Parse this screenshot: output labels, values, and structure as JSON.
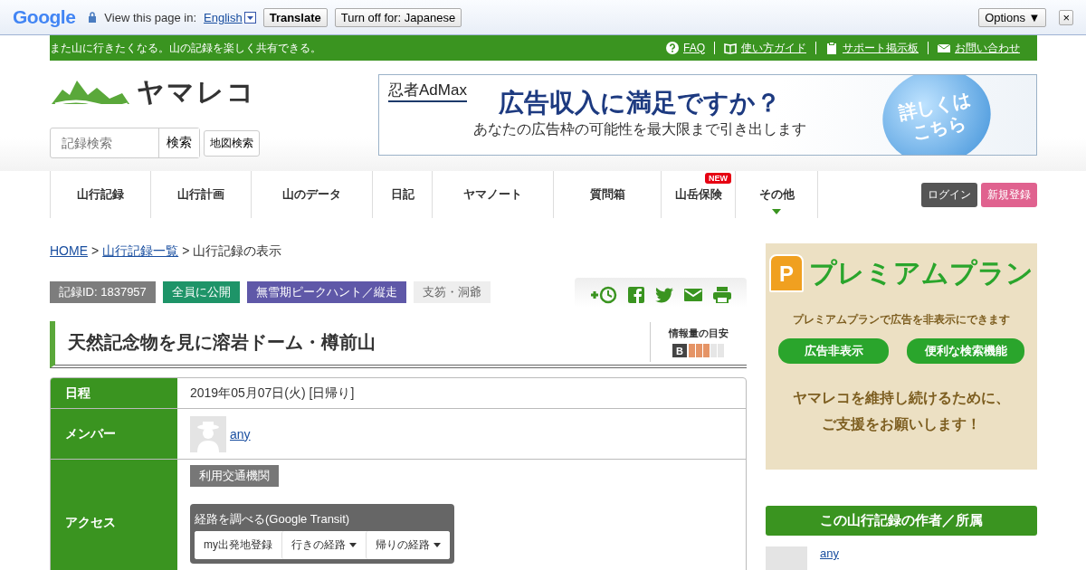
{
  "translate_bar": {
    "logo": "Google",
    "prompt": "View this page in:",
    "language": "English",
    "translate_button": "Translate",
    "turn_off_button": "Turn off for: Japanese",
    "options_button": "Options ▼",
    "close": "×"
  },
  "top_bar": {
    "tagline": "また山に行きたくなる。山の記録を楽しく共有できる。",
    "links": [
      {
        "label": "FAQ"
      },
      {
        "label": "使い方ガイド"
      },
      {
        "label": "サポート掲示板"
      },
      {
        "label": "お問い合わせ"
      }
    ]
  },
  "header": {
    "logo": "ヤマレコ",
    "search": {
      "placeholder": "記録検索",
      "button": "検索"
    },
    "map_search_button": "地図検索"
  },
  "ad_banner": {
    "brand": "忍者AdMax",
    "headline": "広告収入に満足ですか？",
    "subline": "あなたの広告枠の可能性を最大限まで引き出します",
    "cta_lines": [
      "詳しくは",
      "こちら"
    ]
  },
  "nav": {
    "items": [
      {
        "label": "山行記録"
      },
      {
        "label": "山行計画"
      },
      {
        "label": "山のデータ"
      },
      {
        "label": "日記"
      },
      {
        "label": "ヤマノート"
      },
      {
        "label": "質問箱"
      },
      {
        "label": "山岳保険",
        "badge": "NEW"
      },
      {
        "label": "その他",
        "has_menu": true
      }
    ],
    "account_buttons": [
      {
        "label": "ログイン",
        "kind": "login"
      },
      {
        "label": "新規登録",
        "kind": "register"
      }
    ]
  },
  "breadcrumb": {
    "separator": ">",
    "items": [
      {
        "label": "HOME",
        "link": true
      },
      {
        "label": "山行記録一覧",
        "link": true
      },
      {
        "label": "山行記録の表示",
        "link": false
      }
    ]
  },
  "tags": [
    {
      "label": "記録ID: 1837957",
      "color": "#7d7d7d"
    },
    {
      "label": "全員に公開",
      "color": "#1e9468"
    },
    {
      "label": "無雪期ピークハント／縦走",
      "color": "#5f58a8"
    },
    {
      "label": "支笏・洞爺",
      "color": "#eeeeee"
    }
  ],
  "title": "天然記念物を見に溶岩ドーム・樽前山",
  "info_meter": {
    "label": "情報量の目安",
    "grade": "B",
    "level": 0.6
  },
  "details": [
    {
      "kind": "date",
      "label": "日程",
      "value": "2019年05月07日(火) [日帰り]"
    },
    {
      "kind": "member",
      "label": "メンバー",
      "value": "any"
    },
    {
      "kind": "access",
      "label": "アクセス",
      "tag": "利用交通機関",
      "transit_title": "経路を調べる(Google Transit)",
      "transit_buttons": [
        {
          "label": "my出発地登録",
          "has_menu": false
        },
        {
          "label": "行きの経路",
          "has_menu": true
        },
        {
          "label": "帰りの経路",
          "has_menu": true
        }
      ]
    }
  ],
  "premium_banner": {
    "icon_letter": "P",
    "title": "プレミアムプラン",
    "subtitle": "プレミアムプランで広告を非表示にできます",
    "features": [
      "広告非表示",
      "便利な検索機能"
    ],
    "message_lines": [
      "ヤマレコを維持し続けるために、",
      "ご支援をお願いします！"
    ]
  },
  "author": {
    "heading": "この山行記録の作者／所属",
    "name": "any"
  }
}
